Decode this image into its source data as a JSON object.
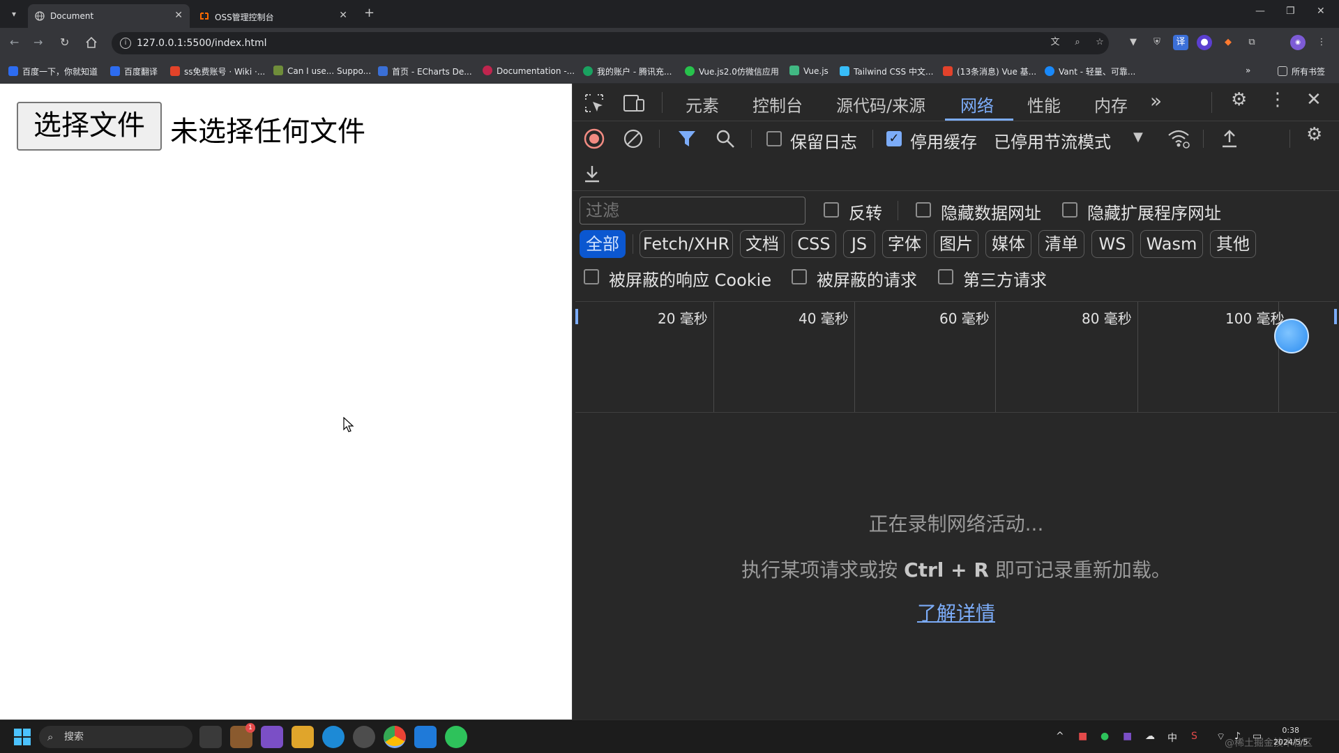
{
  "browser": {
    "tabs": [
      {
        "title": "Document",
        "active": true
      },
      {
        "title": "OSS管理控制台",
        "active": false
      }
    ],
    "url": "127.0.0.1:5500/index.html",
    "new_tab": "+",
    "bookmarks": [
      "百度一下，你就知道",
      "百度翻译",
      "ss免费账号 · Wiki ·...",
      "Can I use... Suppo...",
      "首页 - ECharts De...",
      "Documentation -...",
      "我的账户 - 腾讯充...",
      "Vue.js2.0仿微信应用",
      "Vue.js",
      "Tailwind CSS 中文...",
      "(13条消息) Vue 基...",
      "Vant - 轻量、可靠..."
    ],
    "all_bookmarks": "所有书签",
    "overflow": "»"
  },
  "page": {
    "file_button": "选择文件",
    "file_status": "未选择任何文件"
  },
  "devtools": {
    "tabs": [
      "元素",
      "控制台",
      "源代码/来源",
      "网络",
      "性能",
      "内存"
    ],
    "active_tab": "网络",
    "more_tabs": "»",
    "toolbar": {
      "preserve_log": "保留日志",
      "preserve_log_checked": false,
      "disable_cache": "停用缓存",
      "disable_cache_checked": true,
      "throttling": "已停用节流模式"
    },
    "filter": {
      "placeholder": "过滤",
      "invert": "反转",
      "hide_data_urls": "隐藏数据网址",
      "hide_extension_urls": "隐藏扩展程序网址",
      "types": [
        "全部",
        "Fetch/XHR",
        "文档",
        "CSS",
        "JS",
        "字体",
        "图片",
        "媒体",
        "清单",
        "WS",
        "Wasm",
        "其他"
      ],
      "active_type": "全部",
      "blocked_cookies": "被屏蔽的响应 Cookie",
      "blocked_requests": "被屏蔽的请求",
      "third_party": "第三方请求"
    },
    "timeline_ticks": [
      "20 毫秒",
      "40 毫秒",
      "60 毫秒",
      "80 毫秒",
      "100 毫秒"
    ],
    "empty": {
      "recording": "正在录制网络活动...",
      "hint_prefix": "执行某项请求或按",
      "hint_keys": "Ctrl + R",
      "hint_suffix": "即可记录重新加载。",
      "learn_more": "了解详情"
    }
  },
  "taskbar": {
    "search": "搜索",
    "ime": "中",
    "time": "0:38",
    "date": "2024/5/5",
    "notification_badge": "1",
    "watermark": "@稀土掘金技术社区"
  },
  "colors": {
    "accent": "#7cacf8",
    "chip_active": "#0b57d0",
    "record_red": "#f28b82",
    "devtools_bg": "#282828"
  }
}
